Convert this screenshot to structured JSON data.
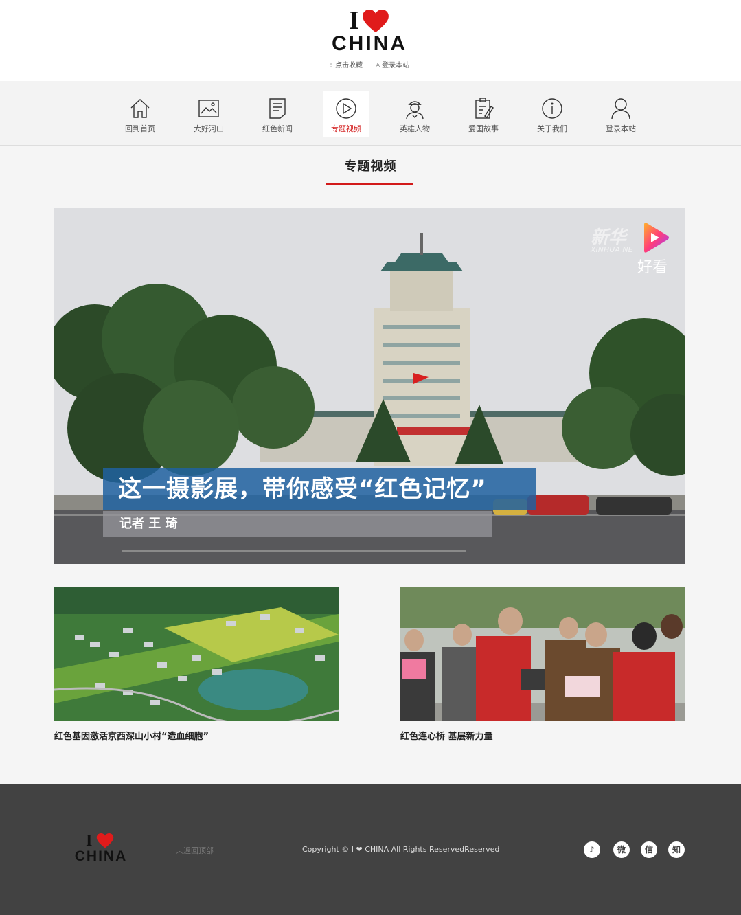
{
  "header": {
    "logo_i": "I",
    "logo_china": "CHINA",
    "favorite_label": "点击收藏",
    "login_label": "登录本站"
  },
  "nav": {
    "items": [
      {
        "label": "回到首页",
        "icon": "home-icon"
      },
      {
        "label": "大好河山",
        "icon": "landscape-icon"
      },
      {
        "label": "红色新闻",
        "icon": "news-icon"
      },
      {
        "label": "专题视频",
        "icon": "play-icon",
        "active": true
      },
      {
        "label": "英雄人物",
        "icon": "soldier-icon"
      },
      {
        "label": "爱国故事",
        "icon": "clipboard-icon"
      },
      {
        "label": "关于我们",
        "icon": "info-icon"
      },
      {
        "label": "登录本站",
        "icon": "user-icon"
      }
    ]
  },
  "section": {
    "title": "专题视频"
  },
  "hero": {
    "caption": "这一摄影展，带你感受“红色记忆”",
    "reporter": "记者 王 琦",
    "watermark_cn": "新华",
    "watermark_en": "XINHUA NE",
    "watermark_brand": "好看"
  },
  "cards": [
    {
      "title": "红色基因激活京西深山小村“造血细胞”"
    },
    {
      "title": "红色连心桥 基层新力量"
    }
  ],
  "footer": {
    "logo_i": "I",
    "logo_china": "CHINA",
    "back_top": "返回顶部",
    "copyright": "Copyright © I ❤ CHINA All Rights ReservedReserved",
    "social": [
      "♪",
      "微",
      "信",
      "知"
    ]
  },
  "colors": {
    "accent": "#d21a1a",
    "footer_bg": "#424242",
    "caption_bg": "#2062a0"
  }
}
